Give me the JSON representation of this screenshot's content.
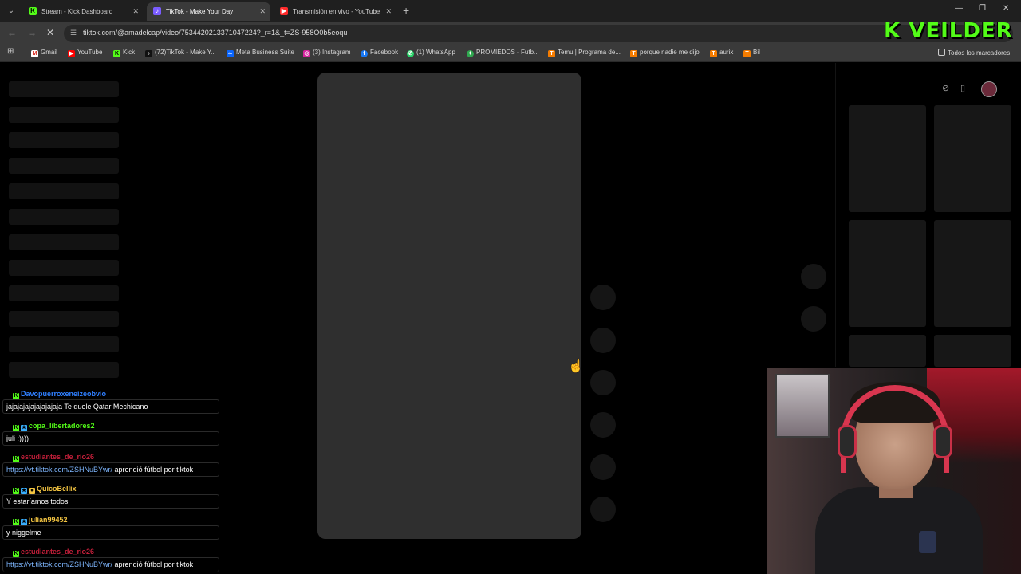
{
  "browser": {
    "tabs": [
      {
        "title": "Stream - Kick Dashboard",
        "icon": "kick-icon",
        "active": false
      },
      {
        "title": "TikTok - Make Your Day",
        "icon": "tiktok-icon",
        "active": true
      },
      {
        "title": "Transmisión en vivo - YouTube",
        "icon": "youtube-icon",
        "active": false
      }
    ],
    "url": "tiktok.com/@amadelcap/video/7534420213371047224?_r=1&_t=ZS-958O0b5eoqu",
    "bookmarks": [
      {
        "label": "Gmail",
        "icon": "gmail-icon"
      },
      {
        "label": "YouTube",
        "icon": "youtube-icon"
      },
      {
        "label": "Kick",
        "icon": "kick-icon"
      },
      {
        "label": "(72)TikTok - Make Y...",
        "icon": "tiktok-icon"
      },
      {
        "label": "Meta Business Suite",
        "icon": "meta-icon"
      },
      {
        "label": "(3) Instagram",
        "icon": "instagram-icon"
      },
      {
        "label": "Facebook",
        "icon": "facebook-icon"
      },
      {
        "label": "(1) WhatsApp",
        "icon": "whatsapp-icon"
      },
      {
        "label": "PROMIEDOS - Futb...",
        "icon": "promiedos-icon"
      },
      {
        "label": "Temu | Programa de...",
        "icon": "temu-icon"
      },
      {
        "label": "porque nadie me dijo",
        "icon": "temu-icon"
      },
      {
        "label": "aurix",
        "icon": "temu-icon"
      },
      {
        "label": "Bil",
        "icon": "temu-icon"
      }
    ],
    "all_bookmarks_label": "Todos los marcadores"
  },
  "overlay": {
    "logo_text": "K VEILDER"
  },
  "chat": [
    {
      "user": "Davopuerroxeneizeobvio",
      "user_color": "#2f7fff",
      "badges": [],
      "message": "jajajajajajajajajaja Te duele Qatar Mechicano",
      "link": ""
    },
    {
      "user": "copa_libertadores2",
      "user_color": "#53fc18",
      "badges": [
        "sub"
      ],
      "message": "juli :))))",
      "link": ""
    },
    {
      "user": "estudiantes_de_rio26",
      "user_color": "#c41f3a",
      "badges": [],
      "message": "aprendió fútbol por tiktok",
      "link": "https://vt.tiktok.com/ZSHNuBYwr/"
    },
    {
      "user": "QuicoBellix",
      "user_color": "#f4c542",
      "badges": [
        "sub",
        "gift"
      ],
      "message": "Y estaríamos todos",
      "link": ""
    },
    {
      "user": "julian99452",
      "user_color": "#f4c542",
      "badges": [
        "sub"
      ],
      "message": "y niggelme",
      "link": ""
    },
    {
      "user": "estudiantes_de_rio26",
      "user_color": "#c41f3a",
      "badges": [],
      "message": "aprendió fútbol por tiktok",
      "link": "https://vt.tiktok.com/ZSHNuBYwr/"
    }
  ]
}
